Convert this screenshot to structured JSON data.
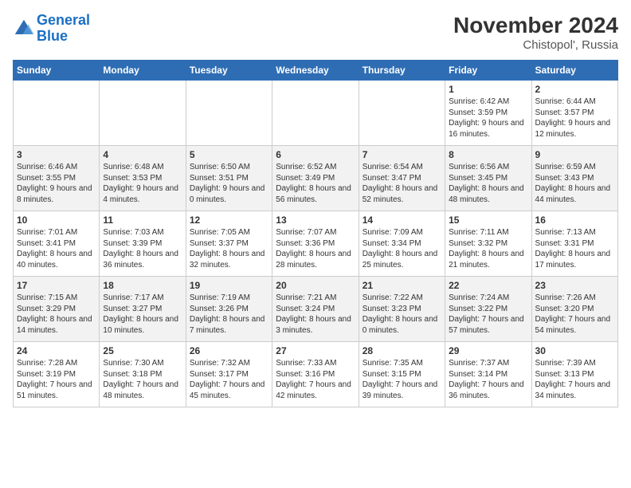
{
  "logo": {
    "line1": "General",
    "line2": "Blue"
  },
  "title": "November 2024",
  "location": "Chistopol', Russia",
  "days_header": [
    "Sunday",
    "Monday",
    "Tuesday",
    "Wednesday",
    "Thursday",
    "Friday",
    "Saturday"
  ],
  "weeks": [
    [
      {
        "day": "",
        "text": ""
      },
      {
        "day": "",
        "text": ""
      },
      {
        "day": "",
        "text": ""
      },
      {
        "day": "",
        "text": ""
      },
      {
        "day": "",
        "text": ""
      },
      {
        "day": "1",
        "text": "Sunrise: 6:42 AM\nSunset: 3:59 PM\nDaylight: 9 hours and 16 minutes."
      },
      {
        "day": "2",
        "text": "Sunrise: 6:44 AM\nSunset: 3:57 PM\nDaylight: 9 hours and 12 minutes."
      }
    ],
    [
      {
        "day": "3",
        "text": "Sunrise: 6:46 AM\nSunset: 3:55 PM\nDaylight: 9 hours and 8 minutes."
      },
      {
        "day": "4",
        "text": "Sunrise: 6:48 AM\nSunset: 3:53 PM\nDaylight: 9 hours and 4 minutes."
      },
      {
        "day": "5",
        "text": "Sunrise: 6:50 AM\nSunset: 3:51 PM\nDaylight: 9 hours and 0 minutes."
      },
      {
        "day": "6",
        "text": "Sunrise: 6:52 AM\nSunset: 3:49 PM\nDaylight: 8 hours and 56 minutes."
      },
      {
        "day": "7",
        "text": "Sunrise: 6:54 AM\nSunset: 3:47 PM\nDaylight: 8 hours and 52 minutes."
      },
      {
        "day": "8",
        "text": "Sunrise: 6:56 AM\nSunset: 3:45 PM\nDaylight: 8 hours and 48 minutes."
      },
      {
        "day": "9",
        "text": "Sunrise: 6:59 AM\nSunset: 3:43 PM\nDaylight: 8 hours and 44 minutes."
      }
    ],
    [
      {
        "day": "10",
        "text": "Sunrise: 7:01 AM\nSunset: 3:41 PM\nDaylight: 8 hours and 40 minutes."
      },
      {
        "day": "11",
        "text": "Sunrise: 7:03 AM\nSunset: 3:39 PM\nDaylight: 8 hours and 36 minutes."
      },
      {
        "day": "12",
        "text": "Sunrise: 7:05 AM\nSunset: 3:37 PM\nDaylight: 8 hours and 32 minutes."
      },
      {
        "day": "13",
        "text": "Sunrise: 7:07 AM\nSunset: 3:36 PM\nDaylight: 8 hours and 28 minutes."
      },
      {
        "day": "14",
        "text": "Sunrise: 7:09 AM\nSunset: 3:34 PM\nDaylight: 8 hours and 25 minutes."
      },
      {
        "day": "15",
        "text": "Sunrise: 7:11 AM\nSunset: 3:32 PM\nDaylight: 8 hours and 21 minutes."
      },
      {
        "day": "16",
        "text": "Sunrise: 7:13 AM\nSunset: 3:31 PM\nDaylight: 8 hours and 17 minutes."
      }
    ],
    [
      {
        "day": "17",
        "text": "Sunrise: 7:15 AM\nSunset: 3:29 PM\nDaylight: 8 hours and 14 minutes."
      },
      {
        "day": "18",
        "text": "Sunrise: 7:17 AM\nSunset: 3:27 PM\nDaylight: 8 hours and 10 minutes."
      },
      {
        "day": "19",
        "text": "Sunrise: 7:19 AM\nSunset: 3:26 PM\nDaylight: 8 hours and 7 minutes."
      },
      {
        "day": "20",
        "text": "Sunrise: 7:21 AM\nSunset: 3:24 PM\nDaylight: 8 hours and 3 minutes."
      },
      {
        "day": "21",
        "text": "Sunrise: 7:22 AM\nSunset: 3:23 PM\nDaylight: 8 hours and 0 minutes."
      },
      {
        "day": "22",
        "text": "Sunrise: 7:24 AM\nSunset: 3:22 PM\nDaylight: 7 hours and 57 minutes."
      },
      {
        "day": "23",
        "text": "Sunrise: 7:26 AM\nSunset: 3:20 PM\nDaylight: 7 hours and 54 minutes."
      }
    ],
    [
      {
        "day": "24",
        "text": "Sunrise: 7:28 AM\nSunset: 3:19 PM\nDaylight: 7 hours and 51 minutes."
      },
      {
        "day": "25",
        "text": "Sunrise: 7:30 AM\nSunset: 3:18 PM\nDaylight: 7 hours and 48 minutes."
      },
      {
        "day": "26",
        "text": "Sunrise: 7:32 AM\nSunset: 3:17 PM\nDaylight: 7 hours and 45 minutes."
      },
      {
        "day": "27",
        "text": "Sunrise: 7:33 AM\nSunset: 3:16 PM\nDaylight: 7 hours and 42 minutes."
      },
      {
        "day": "28",
        "text": "Sunrise: 7:35 AM\nSunset: 3:15 PM\nDaylight: 7 hours and 39 minutes."
      },
      {
        "day": "29",
        "text": "Sunrise: 7:37 AM\nSunset: 3:14 PM\nDaylight: 7 hours and 36 minutes."
      },
      {
        "day": "30",
        "text": "Sunrise: 7:39 AM\nSunset: 3:13 PM\nDaylight: 7 hours and 34 minutes."
      }
    ]
  ]
}
